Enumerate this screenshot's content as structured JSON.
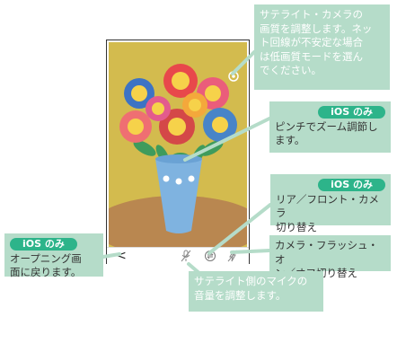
{
  "phone": {
    "back_glyph": "<",
    "icons": [
      "back-icon",
      "mic-icon",
      "camera-switch-icon",
      "flash-icon"
    ]
  },
  "callouts": {
    "quality": {
      "text": "サテライト・カメラの\n画質を調整します。ネッ\nト回線が不安定な場合\nは低画質モードを選ん\nでください。"
    },
    "zoom": {
      "badge": "iOS のみ",
      "text": "ピンチでズーム調節し\nます。"
    },
    "switch": {
      "badge": "iOS のみ",
      "text": "リア／フロント・カメラ\n切り替え"
    },
    "flash": {
      "text": "カメラ・フラッシュ・オ\nン／オフ切り替え"
    },
    "back": {
      "badge": "iOS のみ",
      "text": "オープニング画\n面に戻ります。"
    },
    "mic": {
      "text": "サテライト側のマイクの\n音量を調整します。"
    }
  },
  "colors": {
    "callout": "#b5dcc9",
    "badge": "#2db48a",
    "leader": "#b5dcc9"
  }
}
